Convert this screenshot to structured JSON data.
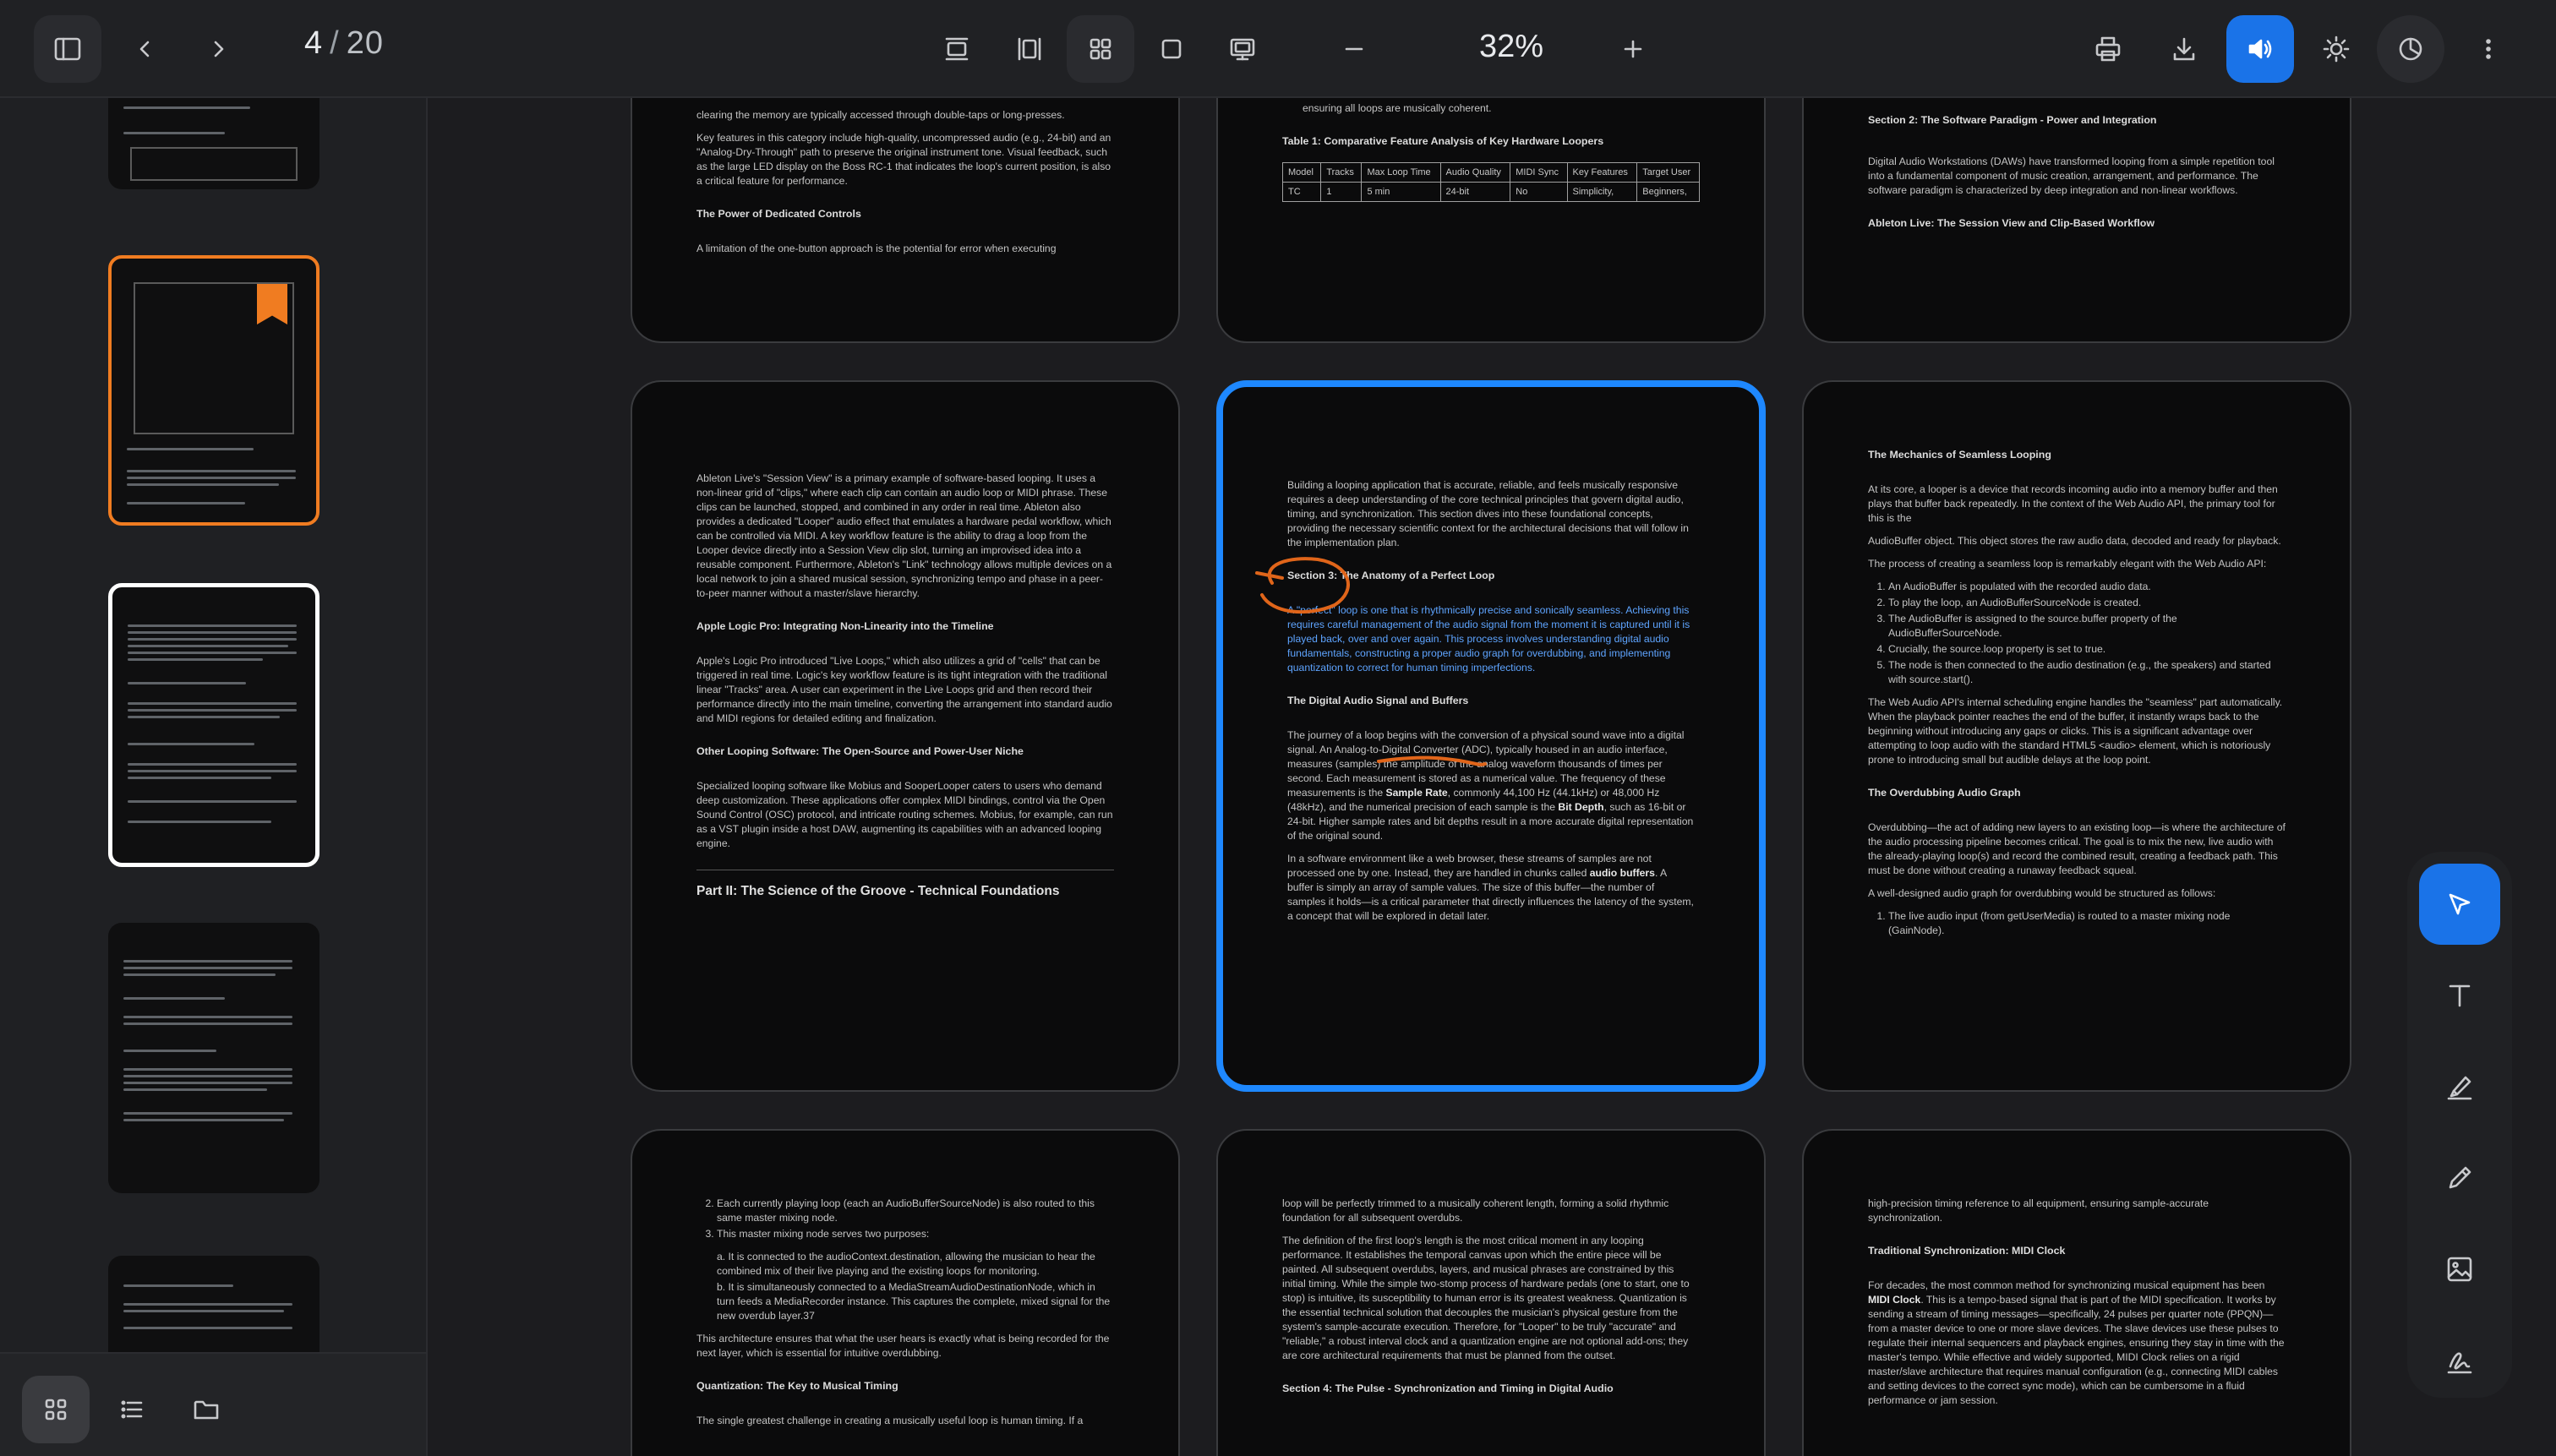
{
  "toolbar": {
    "page_current": "4",
    "page_separator": "/",
    "page_total": "20",
    "zoom": "32%",
    "icons": [
      "sidebar-toggle-icon",
      "chevron-left-icon",
      "chevron-right-icon",
      "single-page-view-icon",
      "two-page-view-icon",
      "grid-view-icon",
      "single-view-icon",
      "presentation-view-icon",
      "zoom-out-icon",
      "zoom-in-icon",
      "print-icon",
      "download-icon",
      "read-aloud-icon",
      "brightness-icon",
      "timer-icon",
      "more-vert-icon"
    ],
    "accent_color": "#1a73e8"
  },
  "sidebar": {
    "footer_icons": [
      "grid-icon",
      "list-icon",
      "folder-icon"
    ],
    "selected_border_color": "#ffffff",
    "bookmarked_border_color": "#f07c21"
  },
  "pages": {
    "p1_top": {
      "lines": [
        "clearing the memory are typically accessed through double-taps or long-presses.",
        "Key features in this category include high-quality, uncompressed audio (e.g., 24-bit) and an \"Analog-Dry-Through\" path to preserve the original instrument tone. Visual feedback, such as the large LED display on the Boss RC-1 that indicates the loop's current position, is also a critical feature for performance."
      ],
      "heading": "The Power of Dedicated Controls",
      "tail": "A limitation of the one-button approach is the potential for error when executing"
    },
    "p2_top": {
      "lead": "ensuring all loops are musically coherent.",
      "table_title": "Table 1: Comparative Feature Analysis of Key Hardware Loopers",
      "table_header": [
        "Model",
        "Tracks",
        "Max Loop Time",
        "Audio Quality",
        "MIDI Sync",
        "Key Features",
        "Target User"
      ],
      "table_row": [
        "TC",
        "1",
        "5 min",
        "24-bit",
        "No",
        "Simplicity,",
        "Beginners,"
      ]
    },
    "p3_top": {
      "heading": "Section 2: The Software Paradigm - Power and Integration",
      "body": "Digital Audio Workstations (DAWs) have transformed looping from a simple repetition tool into a fundamental component of music creation, arrangement, and performance. The software paradigm is characterized by deep integration and non-linear workflows.",
      "subheading": "Ableton Live: The Session View and Clip-Based Workflow"
    },
    "p4": {
      "para1": "Ableton Live's \"Session View\" is a primary example of software-based looping. It uses a non-linear grid of \"clips,\" where each clip can contain an audio loop or MIDI phrase. These clips can be launched, stopped, and combined in any order in real time. Ableton also provides a dedicated \"Looper\" audio effect that emulates a hardware pedal workflow, which can be controlled via MIDI. A key workflow feature is the ability to drag a loop from the Looper device directly into a Session View clip slot, turning an improvised idea into a reusable component. Furthermore, Ableton's \"Link\" technology allows multiple devices on a local network to join a shared musical session, synchronizing tempo and phase in a peer-to-peer manner without a master/slave hierarchy.",
      "h_logic": "Apple Logic Pro: Integrating Non-Linearity into the Timeline",
      "para2": "Apple's Logic Pro introduced \"Live Loops,\" which also utilizes a grid of \"cells\" that can be triggered in real time. Logic's key workflow feature is its tight integration with the traditional linear \"Tracks\" area. A user can experiment in the Live Loops grid and then record their performance directly into the main timeline, converting the arrangement into standard audio and MIDI regions for detailed editing and finalization.",
      "h_other": "Other Looping Software: The Open-Source and Power-User Niche",
      "para3": "Specialized looping software like Mobius and SooperLooper caters to users who demand deep customization. These applications offer complex MIDI bindings, control via the Open Sound Control (OSC) protocol, and intricate routing schemes. Mobius, for example, can run as a VST plugin inside a host DAW, augmenting its capabilities with an advanced looping engine.",
      "part": "Part II: The Science of the Groove - Technical Foundations"
    },
    "p5": {
      "para1": "Building a looping application that is accurate, reliable, and feels musically responsive requires a deep understanding of the core technical principles that govern digital audio, timing, and synchronization. This section dives into these foundational concepts, providing the necessary scientific context for the architectural decisions that will follow in the implementation plan.",
      "h_section3": "Section 3: The Anatomy of a Perfect Loop",
      "highlight": "A \"perfect\" loop is one that is rhythmically precise and sonically seamless. Achieving this requires careful management of the audio signal from the moment it is captured until it is played back, over and over again. This process involves understanding digital audio fundamentals, constructing a proper audio graph for overdubbing, and implementing quantization to correct for human timing imperfections.",
      "h_signal": "The Digital Audio Signal and Buffers",
      "para2_a": "The journey of a loop begins with the conversion of a physical sound wave into a digital signal. An Analog-to-Digital Converter (ADC), typically housed in an audio interface, measures (samples) the amplitude of the analog waveform thousands of times per second. Each measurement is stored as a numerical value. The frequency of these measurements is the ",
      "sample_rate": "Sample Rate",
      "para2_b": ", commonly 44,100 Hz (44.1kHz) or 48,000 Hz (48kHz), and the numerical precision of each sample is the ",
      "bit_depth": "Bit Depth",
      "para2_c": ", such as 16-bit or 24-bit. Higher sample rates and bit depths result in a more accurate digital representation of the original sound.",
      "para3_a": "In a software environment like a web browser, these streams of samples are not processed one by one. Instead, they are handled in chunks called ",
      "audio_buffers": "audio buffers",
      "para3_b": ". A buffer is simply an array of sample values. The size of this buffer—the number of samples it holds—is a critical parameter that directly influences the latency of the system, a concept that will be explored in detail later.",
      "annotation_color": "#e0651a"
    },
    "p6": {
      "heading": "The Mechanics of Seamless Looping",
      "para1": "At its core, a looper is a device that records incoming audio into a memory buffer and then plays that buffer back repeatedly. In the context of the Web Audio API, the primary tool for this is the",
      "para2": "AudioBuffer object. This object stores the raw audio data, decoded and ready for playback.",
      "para3": "The process of creating a seamless loop is remarkably elegant with the Web Audio API:",
      "steps": [
        "An AudioBuffer is populated with the recorded audio data.",
        "To play the loop, an AudioBufferSourceNode is created.",
        "The AudioBuffer is assigned to the source.buffer property of the AudioBufferSourceNode.",
        "Crucially, the source.loop property is set to true.",
        "The node is then connected to the audio destination (e.g., the speakers) and started with source.start()."
      ],
      "para4": "The Web Audio API's internal scheduling engine handles the \"seamless\" part automatically. When the playback pointer reaches the end of the buffer, it instantly wraps back to the beginning without introducing any gaps or clicks. This is a significant advantage over attempting to loop audio with the standard HTML5 <audio> element, which is notoriously prone to introducing small but audible delays at the loop point.",
      "h_overdub": "The Overdubbing Audio Graph",
      "para5": "Overdubbing—the act of adding new layers to an existing loop—is where the architecture of the audio processing pipeline becomes critical. The goal is to mix the new, live audio with the already-playing loop(s) and record the combined result, creating a feedback path. This must be done without creating a runaway feedback squeal.",
      "para6": "A well-designed audio graph for overdubbing would be structured as follows:",
      "graph_step": "The live audio input (from getUserMedia) is routed to a master mixing node (GainNode)."
    },
    "p7": {
      "items": [
        "Each currently playing loop (each an AudioBufferSourceNode) is also routed to this same master mixing node.",
        "This master mixing node serves two purposes:"
      ],
      "sub_a": "a. It is connected to the audioContext.destination, allowing the musician to hear the combined mix of their live playing and the existing loops for monitoring.",
      "sub_b": "b. It is simultaneously connected to a MediaStreamAudioDestinationNode, which in turn feeds a MediaRecorder instance. This captures the complete, mixed signal for the new overdub layer.37",
      "para1": "This architecture ensures that what the user hears is exactly what is being recorded for the next layer, which is essential for intuitive overdubbing.",
      "h_quant": "Quantization: The Key to Musical Timing",
      "tail": "The single greatest challenge in creating a musically useful loop is human timing. If a"
    },
    "p8": {
      "para1": "loop will be perfectly trimmed to a musically coherent length, forming a solid rhythmic foundation for all subsequent overdubs.",
      "para2": "The definition of the first loop's length is the most critical moment in any looping performance. It establishes the temporal canvas upon which the entire piece will be painted. All subsequent overdubs, layers, and musical phrases are constrained by this initial timing. While the simple two-stomp process of hardware pedals (one to start, one to stop) is intuitive, its susceptibility to human error is its greatest weakness. Quantization is the essential technical solution that decouples the musician's physical gesture from the system's sample-accurate execution. Therefore, for \"Looper\" to be truly \"accurate\" and \"reliable,\" a robust interval clock and a quantization engine are not optional add-ons; they are core architectural requirements that must be planned from the outset.",
      "h_section4": "Section 4: The Pulse - Synchronization and Timing in Digital Audio"
    },
    "p9": {
      "lead": "high-precision timing reference to all equipment, ensuring sample-accurate synchronization.",
      "h_midi": "Traditional Synchronization: MIDI Clock",
      "para_a": "For decades, the most common method for synchronizing musical equipment has been ",
      "midi_clock": "MIDI Clock",
      "para_b": ". This is a tempo-based signal that is part of the MIDI specification. It works by sending a stream of timing messages—specifically, 24 pulses per quarter note (PPQN)—from a master device to one or more slave devices. The slave devices use these pulses to regulate their internal sequencers and playback engines, ensuring they stay in time with the master's tempo. While effective and widely supported, MIDI Clock relies on a rigid master/slave architecture that requires manual configuration (e.g., connecting MIDI cables and setting devices to the correct sync mode), which can be cumbersome in a fluid performance or jam session."
    }
  },
  "tool_rail": {
    "icons": [
      "select-pointer-icon",
      "text-icon",
      "highlighter-icon",
      "pen-icon",
      "image-icon",
      "signature-icon"
    ]
  }
}
